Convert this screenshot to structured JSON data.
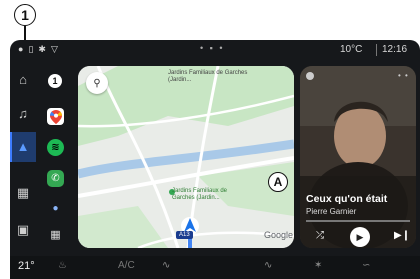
{
  "callouts": {
    "number": "1",
    "map_letter": "A"
  },
  "status_bar": {
    "left_icons": [
      "†",
      "▯",
      "✱",
      "▽"
    ],
    "temperature": "10°C",
    "time": "12:16"
  },
  "app_strip": {
    "notification_count": "1",
    "apps": [
      "maps-icon",
      "spotify-icon",
      "phone-icon",
      "mic-icon",
      "app-grid-icon"
    ]
  },
  "map": {
    "top_label": "Jardins Familiaux de Garches (Jardin...",
    "park_label": "Jardins Familiaux de Garches (Jardin...",
    "road_sign": "A13",
    "attribution": "Google"
  },
  "media": {
    "song_title": "Ceux qu'on était",
    "artist": "Pierre Garnier",
    "progress": 0.0
  },
  "climate": {
    "driver_temp": "21°",
    "ac_label": "A/C"
  }
}
